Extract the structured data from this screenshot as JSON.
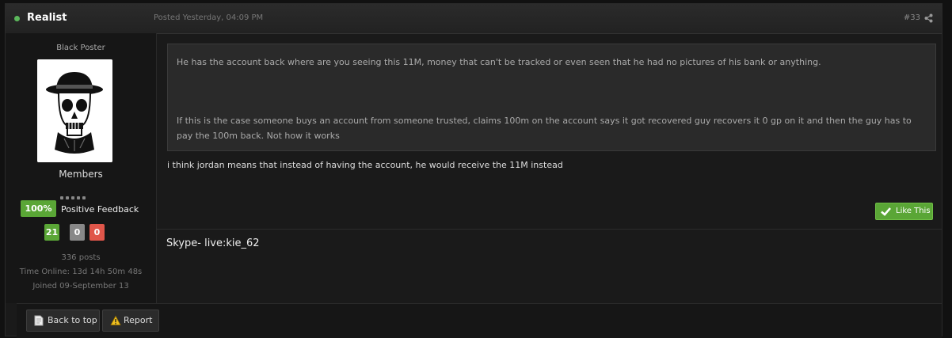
{
  "header": {
    "author": "Realist",
    "posted": "Posted Yesterday, 04:09 PM",
    "post_number": "#33"
  },
  "sidebar": {
    "title": "Black Poster",
    "group": "Members",
    "feedback_percent": "100%",
    "feedback_label": "Positive Feedback",
    "feedback_positive": "21",
    "feedback_neutral": "0",
    "feedback_negative": "0",
    "posts": "336 posts",
    "time_online": "Time Online: 13d 14h 50m 48s",
    "joined": "Joined 09-September 13"
  },
  "post": {
    "quote_line1": "He has the account back where are you seeing this 11M, money that can't be tracked or even seen that he had no pictures of his bank  or anything.",
    "quote_line2": "If this is the case someone buys an account from someone trusted, claims 100m on the account says it got recovered guy recovers it 0 gp on it and then the guy has to pay the 100m back. Not how it works",
    "reply": "i think jordan means that instead of having the account, he would receive the 11M instead",
    "like_label": "Like This",
    "signature": "Skype- live:kie_62"
  },
  "footer": {
    "back_to_top": "Back to top",
    "report": "Report"
  },
  "colors": {
    "online": "#5cb85c",
    "positive": "#5aa636",
    "neutral": "#888888",
    "negative": "#e0564a"
  },
  "icons": [
    "online-dot-icon",
    "share-icon",
    "check-icon",
    "page-icon",
    "warning-icon"
  ]
}
